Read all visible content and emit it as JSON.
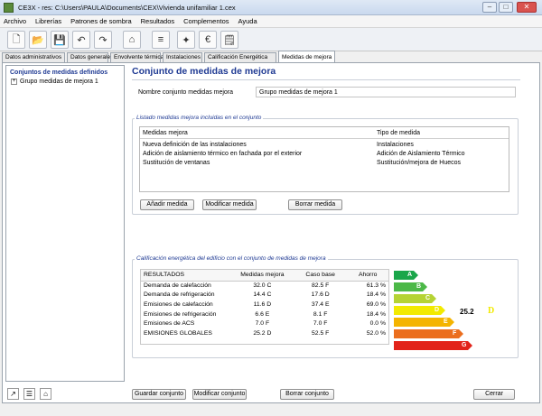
{
  "window": {
    "title": "CE3X - res: C:\\Users\\PAULA\\Documents\\CEX\\Vivienda unifamiliar 1.cex"
  },
  "menu": [
    "Archivo",
    "Librerías",
    "Patrones de sombra",
    "Resultados",
    "Complementos",
    "Ayuda"
  ],
  "toolbar_icons": [
    "new-document-icon",
    "open-folder-icon",
    "save-icon",
    "undo-icon",
    "redo-icon",
    "building-icon",
    "layers-icon",
    "magic-wand-icon",
    "euro-icon",
    "note-icon"
  ],
  "tabs": [
    "Datos administrativos",
    "Datos generales",
    "Envolvente térmica",
    "Instalaciones",
    "Calificación Energética",
    "Medidas de mejora"
  ],
  "left_panel": {
    "title": "Conjuntos de medidas definidos",
    "items": [
      "Grupo medidas de mejora 1"
    ]
  },
  "main": {
    "heading": "Conjunto de medidas de mejora",
    "name_label": "Nombre conjunto medidas mejora",
    "name_value": "Grupo medidas de mejora 1",
    "list_title": "Listado medidas mejora incluidas en el conjunto",
    "list_headers": [
      "Medidas mejora",
      "Tipo de medida"
    ],
    "list_rows": [
      [
        "Nueva definición de las instalaciones",
        "Instalaciones"
      ],
      [
        "Adición de aislamiento térmico en fachada por el exterior",
        "Adición de Aislamiento Térmico"
      ],
      [
        "Sustitución de ventanas",
        "Sustitución/mejora de Huecos"
      ]
    ],
    "buttons": {
      "add": "Añadir medida",
      "modify": "Modificar medida",
      "delete": "Borrar medida"
    }
  },
  "rating": {
    "title": "Calificación energética del edificio con el conjunto de medidas de mejora",
    "headers": [
      "RESULTADOS",
      "Medidas mejora",
      "Caso base",
      "Ahorro"
    ],
    "rows": [
      [
        "Demanda de calefacción",
        "32.0 C",
        "82.5 F",
        "61.3 %"
      ],
      [
        "Demanda de refrigeración",
        "14.4 C",
        "17.6 D",
        "18.4 %"
      ],
      [
        "Emisiones de calefacción",
        "11.6 D",
        "37.4 E",
        "69.0 %"
      ],
      [
        "Emisiones de refrigeración",
        "6.6 E",
        "8.1 F",
        "18.4 %"
      ],
      [
        "Emisiones de ACS",
        "7.0 F",
        "7.0 F",
        "0.0 %"
      ],
      [
        "EMISIONES GLOBALES",
        "25.2 D",
        "52.5 F",
        "52.0 %"
      ]
    ],
    "scale": [
      {
        "letter": "A",
        "color": "#1aa64a"
      },
      {
        "letter": "B",
        "color": "#4cb848"
      },
      {
        "letter": "C",
        "color": "#b5d334"
      },
      {
        "letter": "D",
        "color": "#f2ea00"
      },
      {
        "letter": "E",
        "color": "#f4b400"
      },
      {
        "letter": "F",
        "color": "#eb6e1e"
      },
      {
        "letter": "G",
        "color": "#e2231a"
      }
    ],
    "result_value": "25.2",
    "result_letter": "D",
    "result_color": "#f2ea00"
  },
  "footer": {
    "save": "Guardar conjunto",
    "modify": "Modificar conjunto",
    "delete": "Borrar conjunto",
    "close": "Cerrar",
    "icons": [
      "wand-tool-icon",
      "list-tool-icon",
      "building-tool-icon"
    ]
  }
}
